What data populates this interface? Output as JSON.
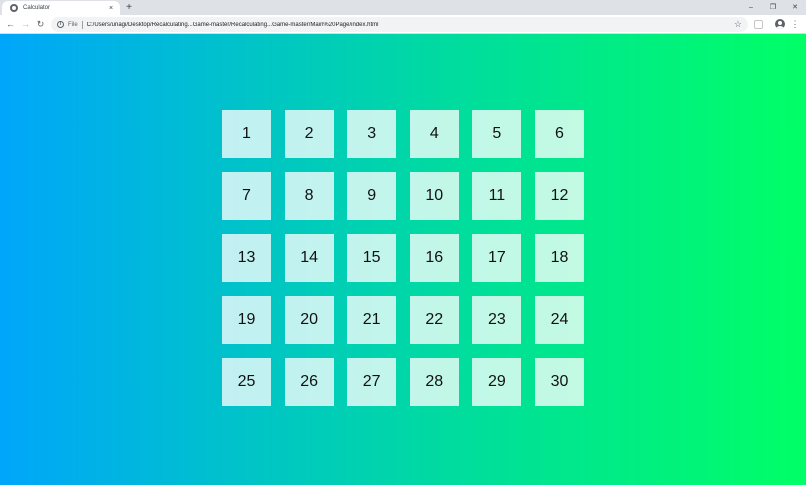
{
  "browser": {
    "tab_title": "Calculator",
    "tab_close": "×",
    "new_tab": "+",
    "window_controls": {
      "minimize": "–",
      "restore": "❐",
      "close": "✕"
    },
    "nav": {
      "back": "←",
      "forward": "→",
      "reload": "↻"
    },
    "omnibox": {
      "scheme_label": "File",
      "url": "C:/Users/unagi/Desktop/Recalculating...Game-master/Recalculating...Game-master/Main%20Page/index.html"
    },
    "icons": {
      "favicon": "globe-icon",
      "info": "info-icon",
      "star": "star-icon",
      "extension": "extension-icon",
      "profile": "profile-icon",
      "menu": "kebab-menu-icon"
    }
  },
  "page": {
    "background_gradient": [
      "#00a6fa",
      "#00dba0",
      "#00ff66"
    ],
    "levels": [
      "1",
      "2",
      "3",
      "4",
      "5",
      "6",
      "7",
      "8",
      "9",
      "10",
      "11",
      "12",
      "13",
      "14",
      "15",
      "16",
      "17",
      "18",
      "19",
      "20",
      "21",
      "22",
      "23",
      "24",
      "25",
      "26",
      "27",
      "28",
      "29",
      "30"
    ]
  }
}
